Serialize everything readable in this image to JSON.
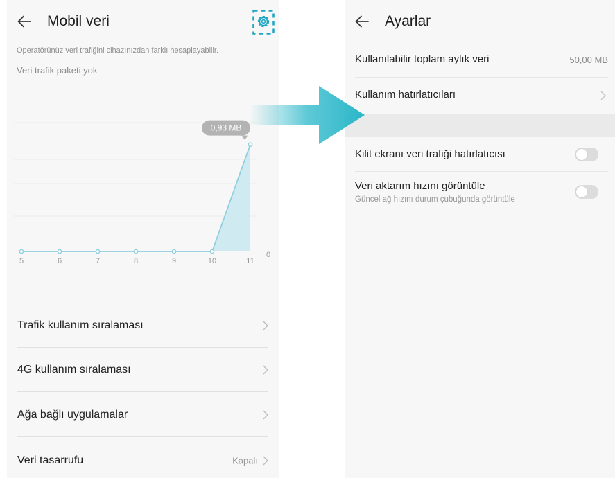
{
  "colors": {
    "accent": "#1aa5c2",
    "arrow": "#2ab7c9",
    "chart_line": "#8fcfe0",
    "chart_fill": "#c9e8f1",
    "bubble": "#b3b3b3"
  },
  "left_screen": {
    "back_icon": "arrow-left-icon",
    "title": "Mobil veri",
    "settings_icon": "gear-icon",
    "quota_note": "Operatörünüz veri trafiğini cihazınızdan farklı hesaplayabilir.",
    "no_package": "Veri trafik paketi yok",
    "menu": [
      {
        "label": "Trafik kullanım sıralaması"
      },
      {
        "label": "4G kullanım sıralaması"
      },
      {
        "label": "Ağa bağlı uygulamalar"
      },
      {
        "label": "Veri tasarrufu",
        "value": "Kapalı"
      }
    ]
  },
  "chart_data": {
    "type": "area",
    "x": [
      "5",
      "6",
      "7",
      "8",
      "9",
      "10",
      "11"
    ],
    "values": [
      0,
      0,
      0,
      0,
      0,
      0,
      0.93
    ],
    "y_tick": "0",
    "callout": "0,93 MB",
    "ylim": [
      0,
      1.0
    ],
    "grid": true
  },
  "right_screen": {
    "back_icon": "arrow-left-icon",
    "title": "Ayarlar",
    "monthly_limit": {
      "label": "Kullanılabilir toplam aylık veri",
      "value": "50,00 MB"
    },
    "reminders": {
      "label": "Kullanım hatırlatıcıları"
    },
    "lockscreen_reminder": {
      "label": "Kilit ekranı veri trafiği hatırlatıcısı",
      "enabled": false
    },
    "show_speed": {
      "label": "Veri aktarım hızını görüntüle",
      "description": "Güncel ağ hızını durum çubuğunda görüntüle",
      "enabled": false
    }
  }
}
